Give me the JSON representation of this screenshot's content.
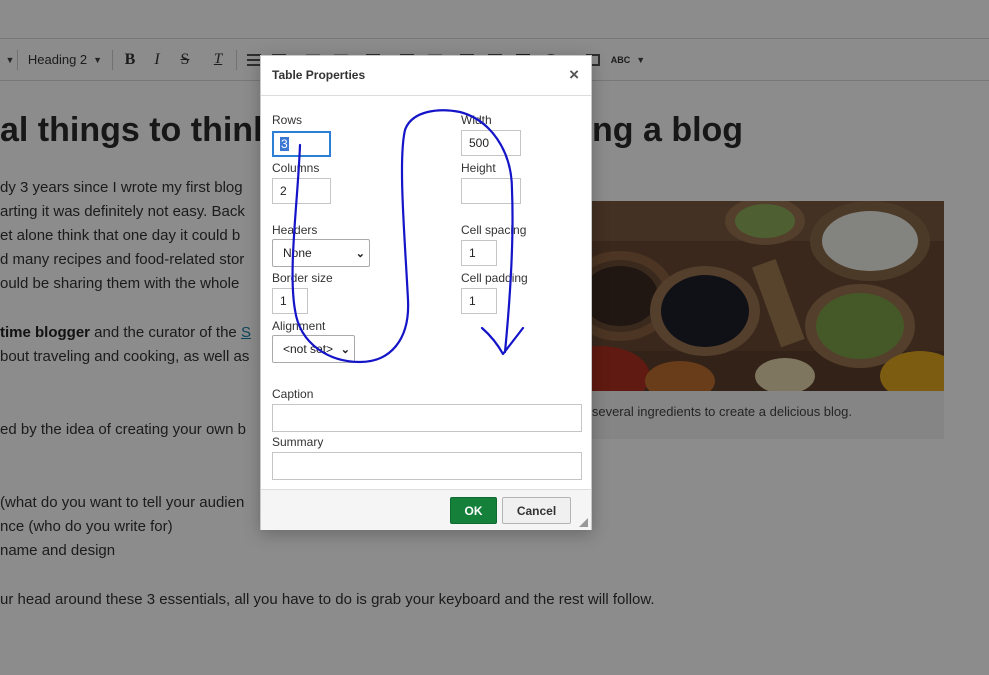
{
  "toolbar": {
    "block_format": "Heading 2",
    "bold": "B",
    "italic": "I",
    "strike": "S",
    "clear_format": "T",
    "spellcheck": "ABC"
  },
  "document": {
    "title": "al things to think",
    "title_end": "ng a blog",
    "lines": [
      "dy 3 years since I wrote my first blog",
      "arting it was definitely not easy. Back",
      "et alone think that one day it could b",
      "d many recipes and food-related stor",
      "ould be sharing them with the whole"
    ],
    "bold_text": "time blogger",
    "line6_rest": " and the curator of the ",
    "link_text": "S",
    "line7": "bout traveling and cooking, as well as",
    "line8": "ed by the idea of creating your own b",
    "list": [
      "(what do you want to tell your audien",
      "nce (who do you write for)",
      "name and design"
    ],
    "closing": "ur head around these 3 essentials, all you have to do is grab your keyboard and the rest will follow.",
    "figure_caption": "kes several ingredients to create a delicious blog."
  },
  "dialog": {
    "title": "Table Properties",
    "close": "×",
    "rows_label": "Rows",
    "rows_value": "3",
    "columns_label": "Columns",
    "columns_value": "2",
    "headers_label": "Headers",
    "headers_value": "None",
    "border_label": "Border size",
    "border_value": "1",
    "alignment_label": "Alignment",
    "alignment_value": "<not set>",
    "width_label": "Width",
    "width_value": "500",
    "height_label": "Height",
    "height_value": "",
    "spacing_label": "Cell spacing",
    "spacing_value": "1",
    "padding_label": "Cell padding",
    "padding_value": "1",
    "caption_label": "Caption",
    "caption_value": "",
    "summary_label": "Summary",
    "summary_value": "",
    "ok": "OK",
    "cancel": "Cancel"
  },
  "colors": {
    "ok_button": "#14803a",
    "focus": "#2d7fd3",
    "link": "#1d7ea5",
    "annotation_ink": "#1414c8"
  },
  "icons": [
    "dropdown-caret-icon",
    "bold-icon",
    "italic-icon",
    "strikethrough-icon",
    "clear-format-icon",
    "ordered-list-icon",
    "bulleted-list-icon",
    "table-icon",
    "maximize-icon",
    "spellcheck-icon",
    "close-icon",
    "resize-grip-icon"
  ]
}
